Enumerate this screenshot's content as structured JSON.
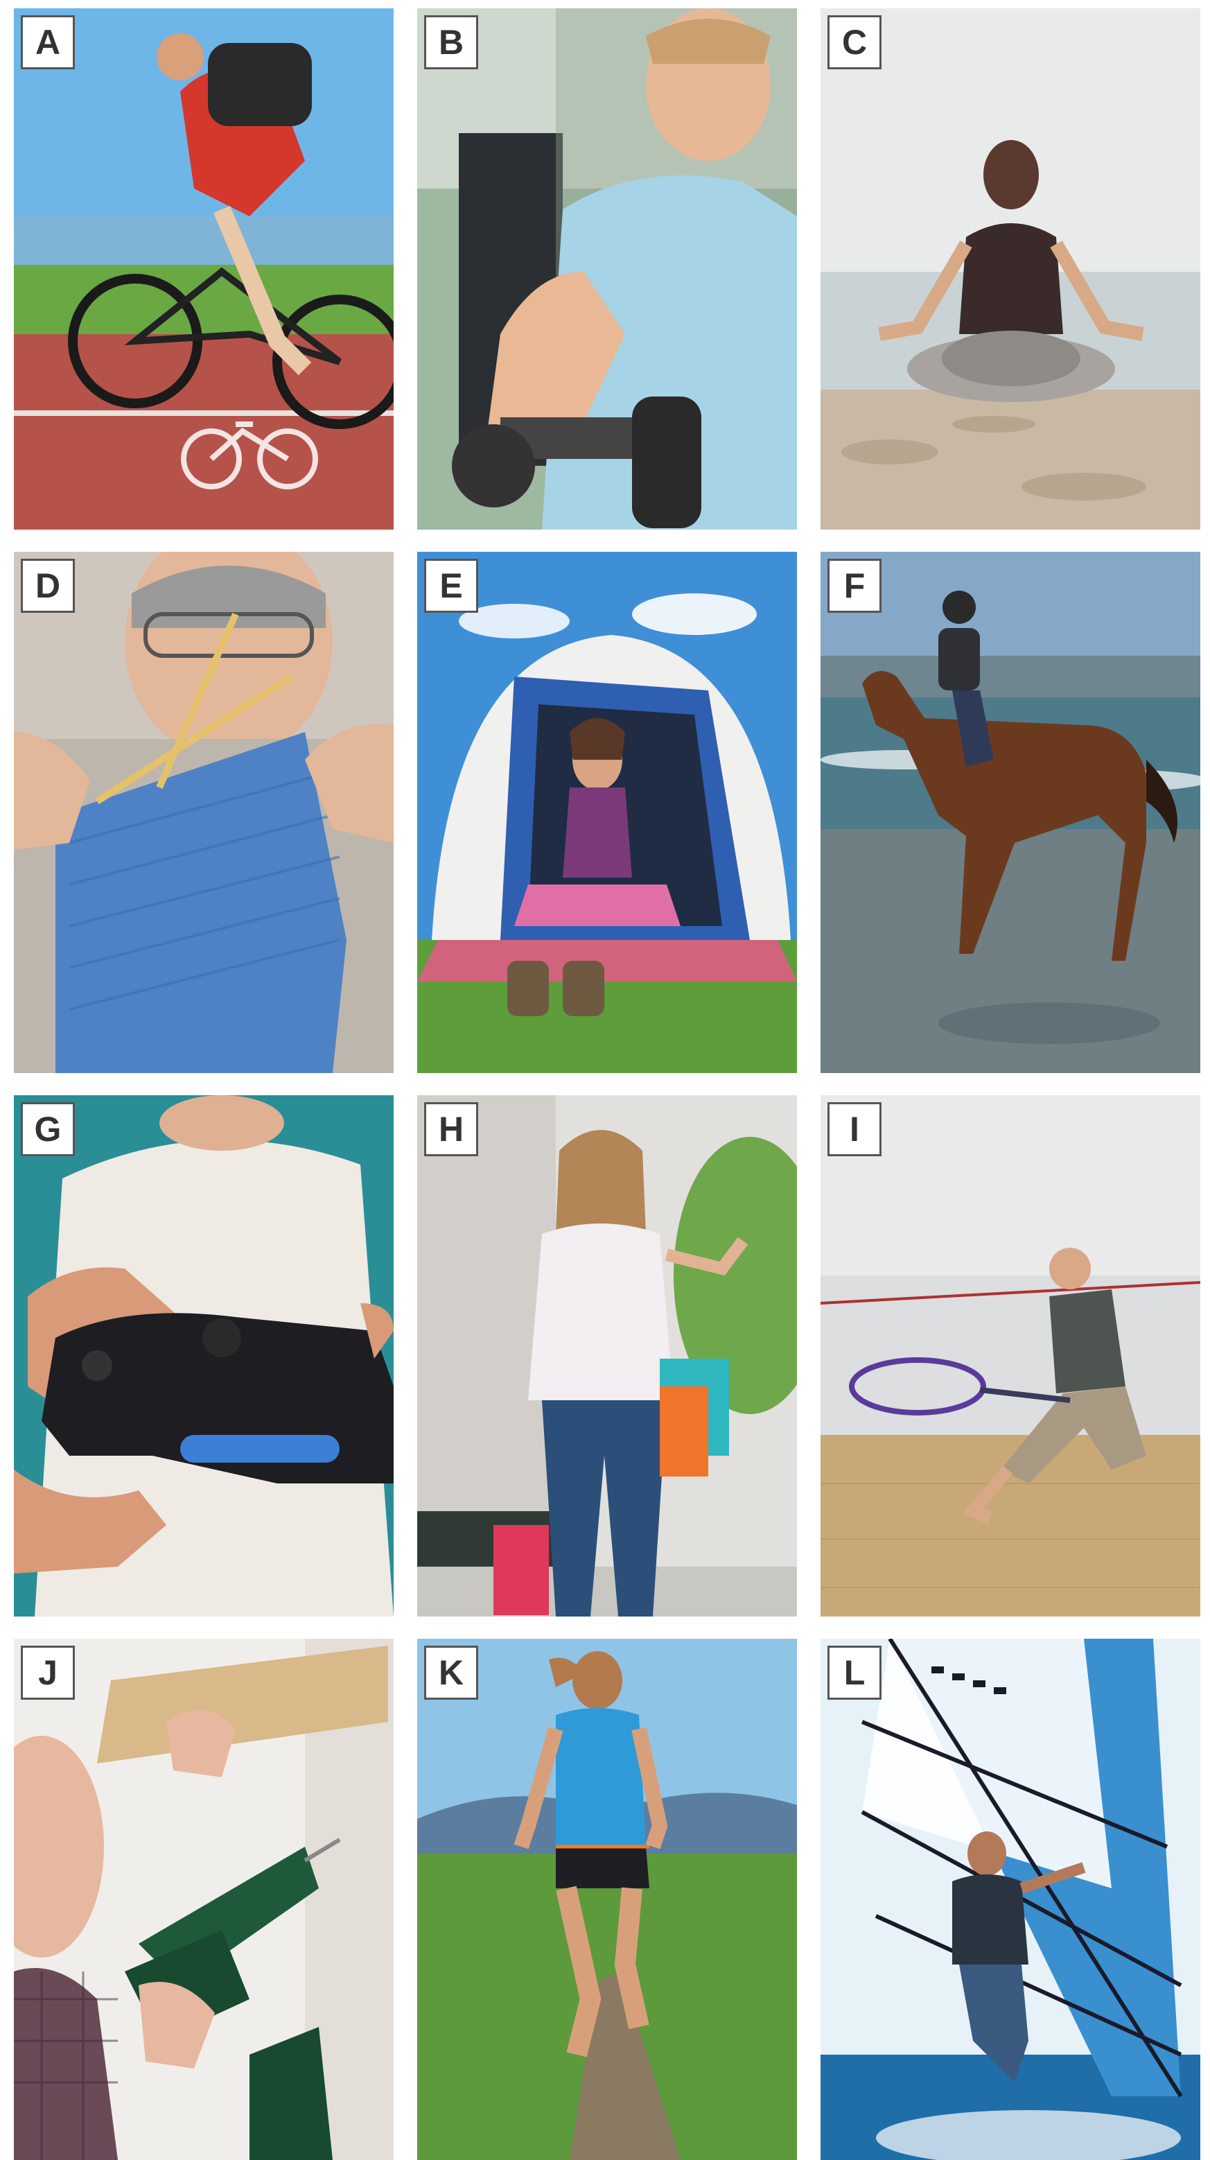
{
  "tiles": [
    {
      "letter": "A",
      "subject": "cycling"
    },
    {
      "letter": "B",
      "subject": "weightlifting"
    },
    {
      "letter": "C",
      "subject": "yoga-meditation"
    },
    {
      "letter": "D",
      "subject": "knitting"
    },
    {
      "letter": "E",
      "subject": "camping"
    },
    {
      "letter": "F",
      "subject": "horse-riding"
    },
    {
      "letter": "G",
      "subject": "video-gaming"
    },
    {
      "letter": "H",
      "subject": "shopping"
    },
    {
      "letter": "I",
      "subject": "squash"
    },
    {
      "letter": "J",
      "subject": "diy-drilling"
    },
    {
      "letter": "K",
      "subject": "running"
    },
    {
      "letter": "L",
      "subject": "windsurfing"
    }
  ],
  "colors": {
    "badge_bg": "#ffffff",
    "badge_border": "#555555",
    "badge_text": "#333333"
  }
}
